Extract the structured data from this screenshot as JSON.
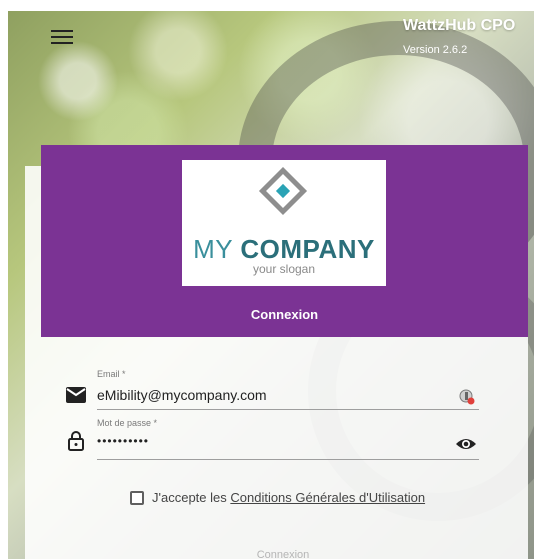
{
  "app": {
    "title": "WattzHub CPO",
    "version": "Version 2.6.2"
  },
  "logo": {
    "company_light": "MY ",
    "company_bold": "COMPANY",
    "slogan": "your slogan"
  },
  "login": {
    "header_title": "Connexion",
    "email": {
      "label": "Email *",
      "value": "eMibility@mycompany.com"
    },
    "password": {
      "label": "Mot de passe *",
      "value": "••••••••••"
    },
    "terms": {
      "prefix": "J'accepte les ",
      "link": "Conditions Générales d'Utilisation",
      "checked": false
    },
    "submit_label": "Connexion"
  },
  "colors": {
    "header_purple": "#7b3394",
    "logo_teal": "#2b6f7a"
  },
  "icons": [
    "menu-icon",
    "mail-icon",
    "lock-icon",
    "visibility-icon",
    "autofill-key-icon"
  ]
}
